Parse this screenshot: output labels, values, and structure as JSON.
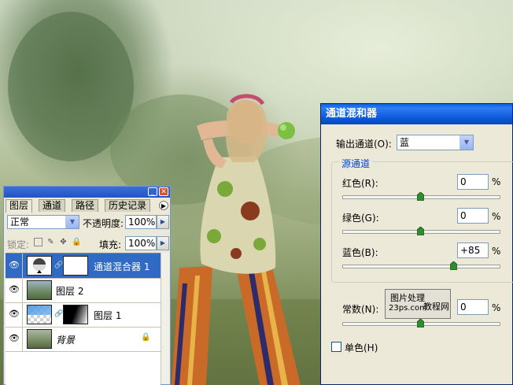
{
  "layers_panel": {
    "tabs": [
      "图层",
      "通道",
      "路径",
      "历史记录"
    ],
    "blend_mode": "正常",
    "opacity_label": "不透明度:",
    "opacity_value": "100%",
    "lock_label": "锁定:",
    "fill_label": "填充:",
    "fill_value": "100%",
    "layers": [
      {
        "name": "通道混合器 1",
        "selected": true,
        "has_mask": true
      },
      {
        "name": "图层 2",
        "selected": false,
        "has_mask": false
      },
      {
        "name": "图层 1",
        "selected": false,
        "has_mask": true
      },
      {
        "name": "背景",
        "selected": false,
        "has_mask": false,
        "locked": true
      }
    ],
    "window_buttons": [
      "minimize-icon",
      "close-icon"
    ]
  },
  "channel_mixer": {
    "title": "通道混和器",
    "output_channel_label": "输出通道(O):",
    "output_channel_value": "蓝",
    "source_group_label": "源通道",
    "channels": [
      {
        "label": "红色(R):",
        "value": "0",
        "unit": "%",
        "level_percent": 0
      },
      {
        "label": "绿色(G):",
        "value": "0",
        "unit": "%",
        "level_percent": 0
      },
      {
        "label": "蓝色(B):",
        "value": "+85",
        "unit": "%",
        "level_percent": 85
      }
    ],
    "constant": {
      "label": "常数(N):",
      "value": "0",
      "unit": "%",
      "level_percent": 0
    },
    "monochrome_label": "单色(H)",
    "monochrome_checked": false
  },
  "watermark": {
    "line1": "图片处理",
    "line2": "23ps.com",
    "line3": "教程网"
  },
  "colors": {
    "titlebar_blue": "#2453c4",
    "selected_row": "#316ac5",
    "group_title": "#0046d5"
  }
}
